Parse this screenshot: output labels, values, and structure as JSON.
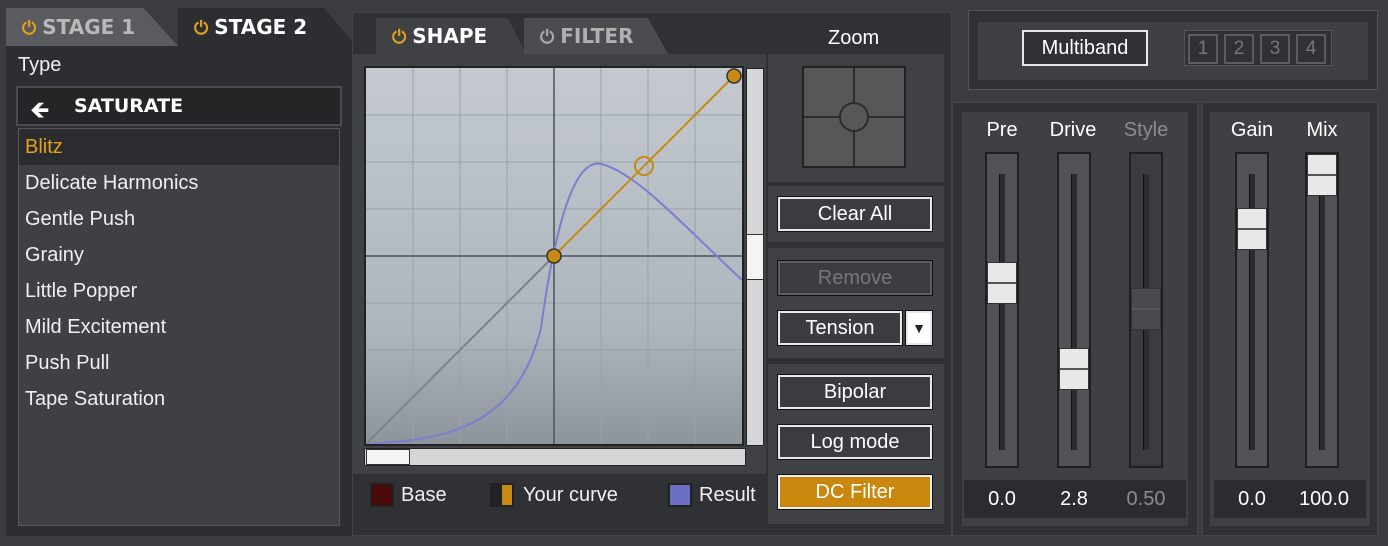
{
  "stages": [
    {
      "label": "STAGE 1",
      "active": false
    },
    {
      "label": "STAGE 2",
      "active": true
    }
  ],
  "type_label": "Type",
  "type_selector": {
    "label": "SATURATE"
  },
  "presets": [
    "Blitz",
    "Delicate Harmonics",
    "Gentle Push",
    "Grainy",
    "Little Popper",
    "Mild Excitement",
    "Push Pull",
    "Tape Saturation"
  ],
  "selected_preset": "Blitz",
  "tabs": {
    "shape": "SHAPE",
    "filter": "FILTER",
    "active": "shape"
  },
  "zoom_label": "Zoom",
  "buttons": {
    "clear_all": "Clear All",
    "remove": "Remove",
    "tension": "Tension",
    "bipolar": "Bipolar",
    "log_mode": "Log mode",
    "dc_filter": "DC Filter"
  },
  "legend": {
    "base": "Base",
    "your_curve": "Your curve",
    "result": "Result"
  },
  "colors": {
    "accent": "#e0a21a",
    "curve": "#c78a14",
    "result": "#7a7fd0",
    "base": "#4a0a0a",
    "dc_filter_active": "#c9870e"
  },
  "multiband": {
    "label": "Multiband",
    "bands": [
      "1",
      "2",
      "3",
      "4"
    ]
  },
  "sliders": {
    "pre": {
      "label": "Pre",
      "value": "0.0"
    },
    "drive": {
      "label": "Drive",
      "value": "2.8"
    },
    "style": {
      "label": "Style",
      "value": "0.50"
    },
    "gain": {
      "label": "Gain",
      "value": "0.0"
    },
    "mix": {
      "label": "Mix",
      "value": "100.0"
    }
  }
}
